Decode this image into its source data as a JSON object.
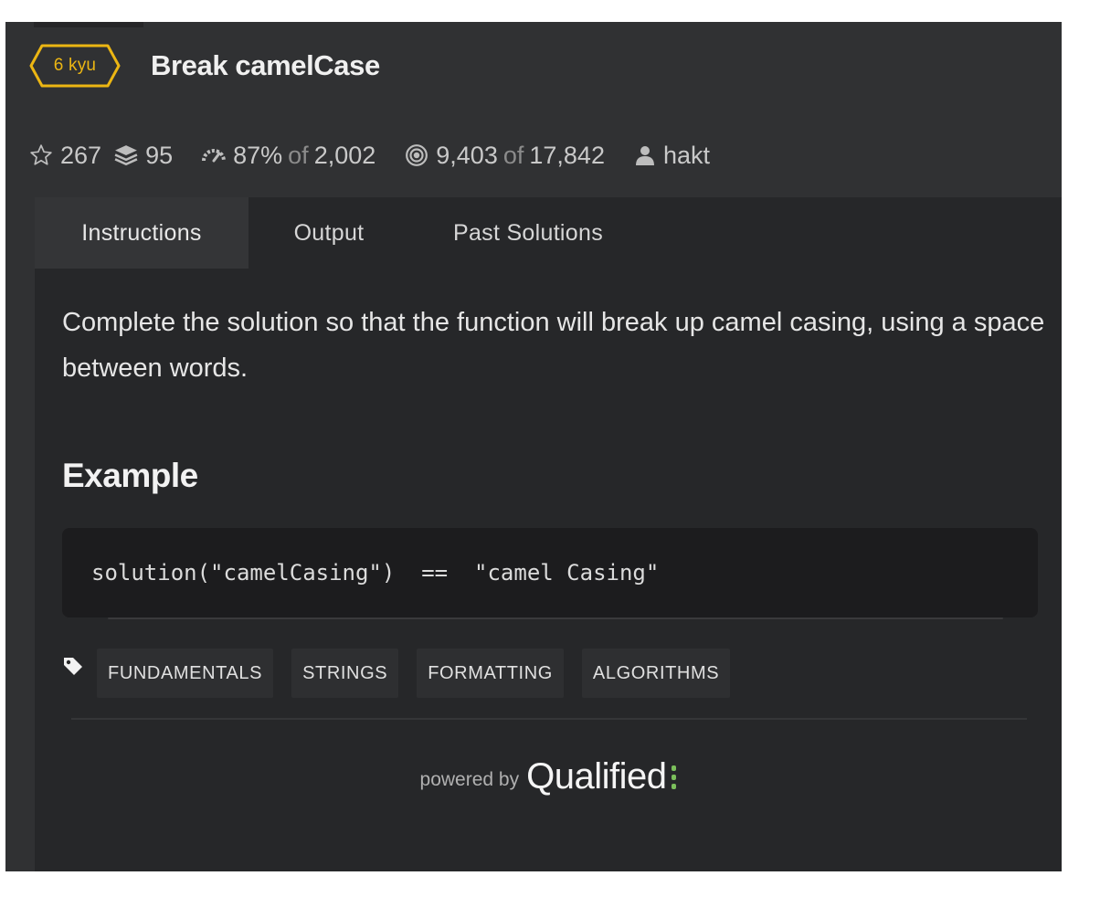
{
  "kata": {
    "rank": "6 kyu",
    "title": "Break camelCase",
    "rank_color": "#ecb613"
  },
  "stats": {
    "stars": "267",
    "collections": "95",
    "satisfaction": "87%",
    "satisfaction_of": "of",
    "votes": "2,002",
    "completed": "9,403",
    "completed_of": "of",
    "attempted": "17,842",
    "author": "hakt"
  },
  "tabs": [
    {
      "label": "Instructions",
      "active": true
    },
    {
      "label": "Output",
      "active": false
    },
    {
      "label": "Past Solutions",
      "active": false
    }
  ],
  "instructions": {
    "description": "Complete the solution so that the function will break up camel casing, using a space between words.",
    "example_heading": "Example",
    "code": "solution(\"camelCasing\")  ==  \"camel Casing\""
  },
  "tags": [
    "FUNDAMENTALS",
    "STRINGS",
    "FORMATTING",
    "ALGORITHMS"
  ],
  "footer": {
    "powered_by": "powered by",
    "brand": "Qualified",
    "brand_accent": "#7bbf5b"
  },
  "icons": {
    "stars": "star-outline-icon",
    "collections": "stack-icon",
    "satisfaction": "gauge-icon",
    "completion": "target-icon",
    "author": "user-icon",
    "tags": "tag-icon"
  }
}
